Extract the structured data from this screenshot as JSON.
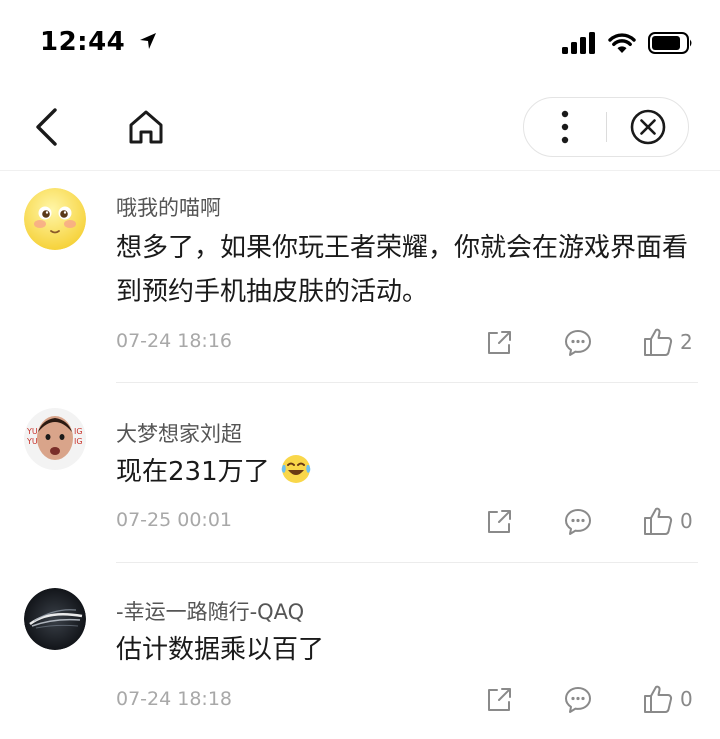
{
  "status_bar": {
    "time": "12:44"
  },
  "nav": {},
  "comments": [
    {
      "username": "哦我的喵啊",
      "content": "想多了，如果你玩王者荣耀，你就会在游戏界面看到预约手机抽皮肤的活动。",
      "time": "07-24 18:16",
      "likes": "2",
      "avatar": "emoji-face"
    },
    {
      "username": "大梦想家刘超",
      "content": "现在231万了",
      "emoji": "laugh-cry-emoji",
      "time": "07-25 00:01",
      "likes": "0",
      "avatar": "man-face"
    },
    {
      "username": "-幸运一路随行-QAQ",
      "content": "估计数据乘以百了",
      "time": "07-24 18:18",
      "likes": "0",
      "avatar": "dark-swirl"
    }
  ],
  "icons": {
    "back": "chevron-left-icon",
    "home": "home-icon",
    "more": "more-vertical-icon",
    "close": "close-circle-icon",
    "share": "share-icon",
    "reply": "comment-icon",
    "like": "thumbs-up-icon"
  }
}
